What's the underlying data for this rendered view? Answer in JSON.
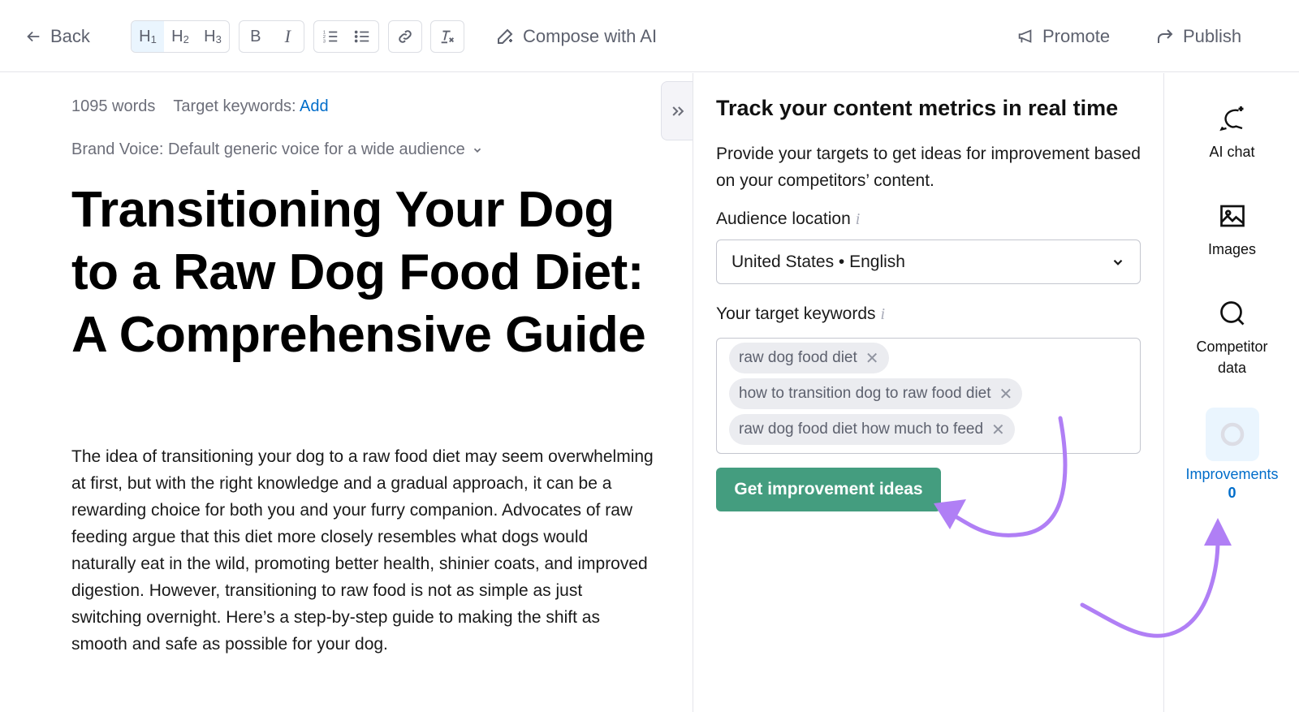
{
  "toolbar": {
    "back_label": "Back",
    "headings": [
      "H",
      "H",
      "H"
    ],
    "heading_subs": [
      "1",
      "2",
      "3"
    ],
    "bold_label": "B",
    "italic_label": "I",
    "compose_label": "Compose with AI",
    "promote_label": "Promote",
    "publish_label": "Publish"
  },
  "editor": {
    "word_count": "1095 words",
    "target_keywords_label": "Target keywords:",
    "target_keywords_add": "Add",
    "brand_voice": "Brand Voice: Default generic voice for a wide audience",
    "title": "Transitioning Your Dog to a Raw Dog Food Diet: A Comprehensive Guide",
    "body": "The idea of transitioning your dog to a raw food diet may seem overwhelming at first, but with the right knowledge and a gradual approach, it can be a rewarding choice for both you and your furry companion. Advocates of raw feeding argue that this diet more closely resembles what dogs would naturally eat in the wild, promoting better health, shinier coats, and improved digestion. However, transitioning to raw food is not as simple as just switching overnight. Here’s a step-by-step guide to making the shift as smooth and safe as possible for your dog."
  },
  "panel": {
    "title": "Track your content metrics in real time",
    "description": "Provide your targets to get ideas for improvement based on your competitors’ content.",
    "audience_label": "Audience location",
    "audience_value": "United States • English",
    "keywords_label": "Your target keywords",
    "keywords": [
      "raw dog food diet",
      "how to transition dog to raw food diet",
      "raw dog food diet how much to feed"
    ],
    "remove_glyph": "✕",
    "info_glyph": "i",
    "cta_label": "Get improvement ideas"
  },
  "rail": {
    "ai_chat": "AI chat",
    "images": "Images",
    "competitor_data": "Competitor data",
    "improvements_label": "Improvements",
    "improvements_count": "0"
  },
  "colors": {
    "accent_green": "#449d7f",
    "link_blue": "#006dca",
    "annotation_purple": "#b07ff5"
  }
}
